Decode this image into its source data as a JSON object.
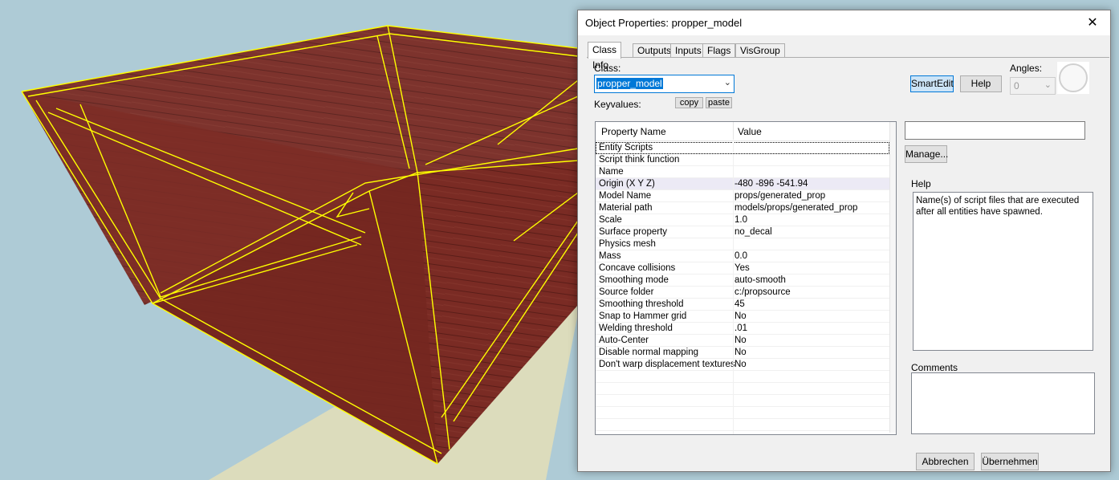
{
  "window": {
    "title": "Object Properties: propper_model",
    "close_glyph": "✕"
  },
  "tabs": [
    {
      "label": "Class Info",
      "active": true
    },
    {
      "label": "Outputs"
    },
    {
      "label": "Inputs"
    },
    {
      "label": "Flags"
    },
    {
      "label": "VisGroup"
    }
  ],
  "class_info": {
    "class_label": "Class:",
    "class_value": "propper_model",
    "keyvalues_label": "Keyvalues:",
    "copy_label": "copy",
    "paste_label": "paste",
    "smartedit_label": "SmartEdit",
    "help_button_label": "Help",
    "angles_label": "Angles:",
    "angles_value": "0"
  },
  "table": {
    "headers": [
      "Property Name",
      "Value"
    ],
    "rows": [
      {
        "name": "Entity Scripts",
        "value": ""
      },
      {
        "name": "Script think function",
        "value": ""
      },
      {
        "name": "Name",
        "value": ""
      },
      {
        "name": "Origin (X Y Z)",
        "value": "-480 -896 -541.94"
      },
      {
        "name": "Model Name",
        "value": "props/generated_prop"
      },
      {
        "name": "Material path",
        "value": "models/props/generated_prop"
      },
      {
        "name": "Scale",
        "value": "1.0"
      },
      {
        "name": "Surface property",
        "value": "no_decal"
      },
      {
        "name": "Physics mesh",
        "value": ""
      },
      {
        "name": "Mass",
        "value": "0.0"
      },
      {
        "name": "Concave collisions",
        "value": "Yes"
      },
      {
        "name": "Smoothing mode",
        "value": "auto-smooth"
      },
      {
        "name": "Source folder",
        "value": "c:/propsource"
      },
      {
        "name": "Smoothing threshold",
        "value": "45"
      },
      {
        "name": "Snap to Hammer grid",
        "value": "No"
      },
      {
        "name": "Welding threshold",
        "value": ".01"
      },
      {
        "name": "Auto-Center",
        "value": "No"
      },
      {
        "name": "Disable normal mapping",
        "value": "No"
      },
      {
        "name": "Don't warp displacement textures",
        "value": "No"
      }
    ]
  },
  "side": {
    "value_field": "",
    "manage_label": "Manage...",
    "help_label": "Help",
    "help_text": "Name(s) of script files that are executed after all entities have spawned.",
    "comments_label": "Comments",
    "comments_text": ""
  },
  "footer": {
    "cancel_label": "Abbrechen",
    "apply_label": "Übernehmen"
  },
  "colors": {
    "sky": "#aecbd6",
    "ground": "#dcdcbc",
    "wood": "#7a2a22",
    "selection": "#ffff00",
    "accent": "#0078d7"
  }
}
